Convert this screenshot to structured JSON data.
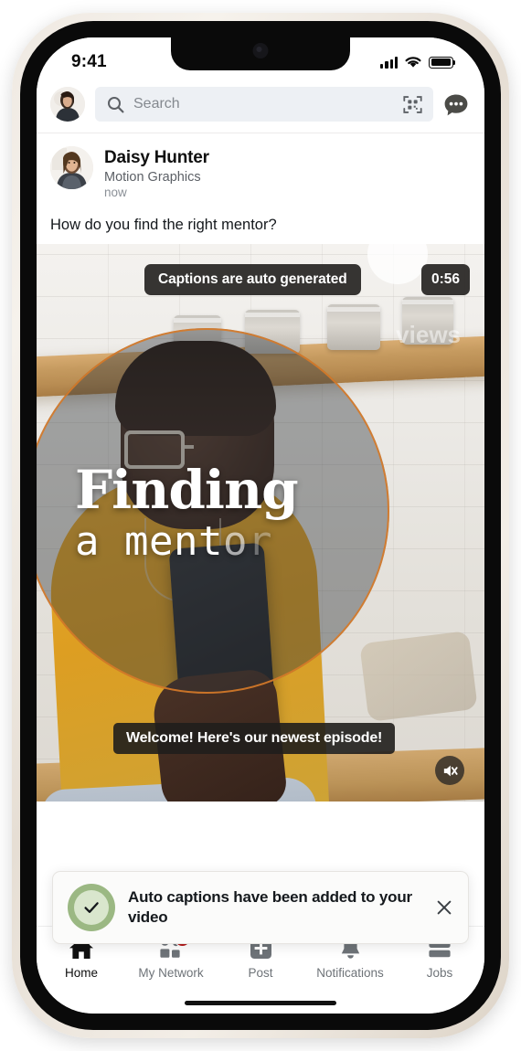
{
  "status_bar": {
    "time": "9:41",
    "icons": [
      "cellular-signal-icon",
      "wifi-icon",
      "battery-icon"
    ]
  },
  "top_bar": {
    "avatar_name": "user-avatar",
    "search": {
      "placeholder": "Search",
      "icon": "search-icon"
    },
    "qr_icon": "qr-scan-icon",
    "messaging_icon": "messaging-icon"
  },
  "post": {
    "author": "Daisy Hunter",
    "headline": "Motion Graphics",
    "timestamp": "now",
    "text": "How do you find the right mentor?",
    "avatar_name": "author-avatar"
  },
  "video": {
    "caption_notice": "Captions are auto generated",
    "duration": "0:56",
    "title_line1": "Finding",
    "title_line2_solid": "a ment",
    "title_line2_fade1": "o",
    "title_line2_fade2": "r",
    "subtitle": "Welcome! Here's our newest episode!",
    "mute_icon": "speaker-muted-icon",
    "watermark": "views",
    "accent_ring_color": "#d67a28"
  },
  "snackbar": {
    "message": "Auto captions have been added to your video",
    "success_icon": "check-circle-icon",
    "close_icon": "close-icon",
    "success_color": "#9bb883"
  },
  "bottom_nav": {
    "items": [
      {
        "label": "Home",
        "icon": "home-icon",
        "active": true,
        "badge": ""
      },
      {
        "label": "My Network",
        "icon": "my-network-icon",
        "active": false,
        "badge": "2"
      },
      {
        "label": "Post",
        "icon": "post-plus-icon",
        "active": false,
        "badge": ""
      },
      {
        "label": "Notifications",
        "icon": "bell-icon",
        "active": false,
        "badge": ""
      },
      {
        "label": "Jobs",
        "icon": "briefcase-icon",
        "active": false,
        "badge": ""
      }
    ]
  }
}
